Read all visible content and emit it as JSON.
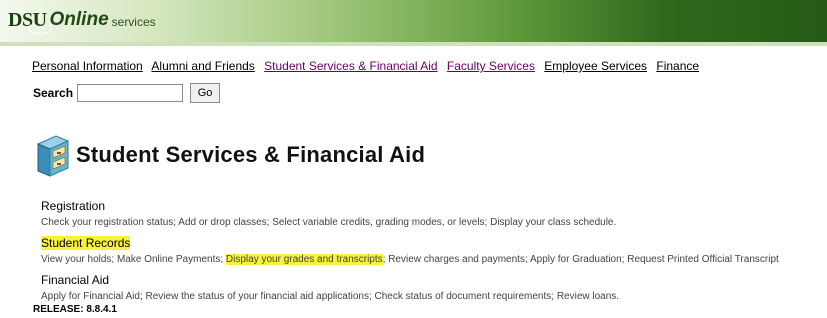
{
  "banner": {
    "dsu": "DSU",
    "online": "Online",
    "services": "services"
  },
  "nav": {
    "items": [
      "Personal Information",
      "Alumni and Friends",
      "Student Services & Financial Aid",
      "Faculty Services",
      "Employee Services",
      "Finance"
    ]
  },
  "search": {
    "label": "Search",
    "value": "",
    "go_label": "Go"
  },
  "page": {
    "title": "Student Services & Financial Aid"
  },
  "menu": {
    "items": [
      {
        "title": "Registration",
        "description": "Check your registration status; Add or drop classes; Select variable credits, grading modes, or levels; Display your class schedule."
      },
      {
        "title": "Student Records",
        "description_before": "View your holds; Make Online Payments;",
        "description_highlight": "Display your grades and transcripts",
        "description_after": "; Review charges and payments; Apply for Graduation; Request Printed Official Transcript"
      },
      {
        "title": "Financial Aid",
        "description": "Apply for Financial Aid; Review the status of your financial aid applications; Check status of document requirements; Review loans."
      }
    ]
  },
  "release": "RELEASE: 8.8.4.1",
  "colors": {
    "highlight": "#f8f23c",
    "banner_dark": "#245a16",
    "visited_link": "#660066"
  }
}
